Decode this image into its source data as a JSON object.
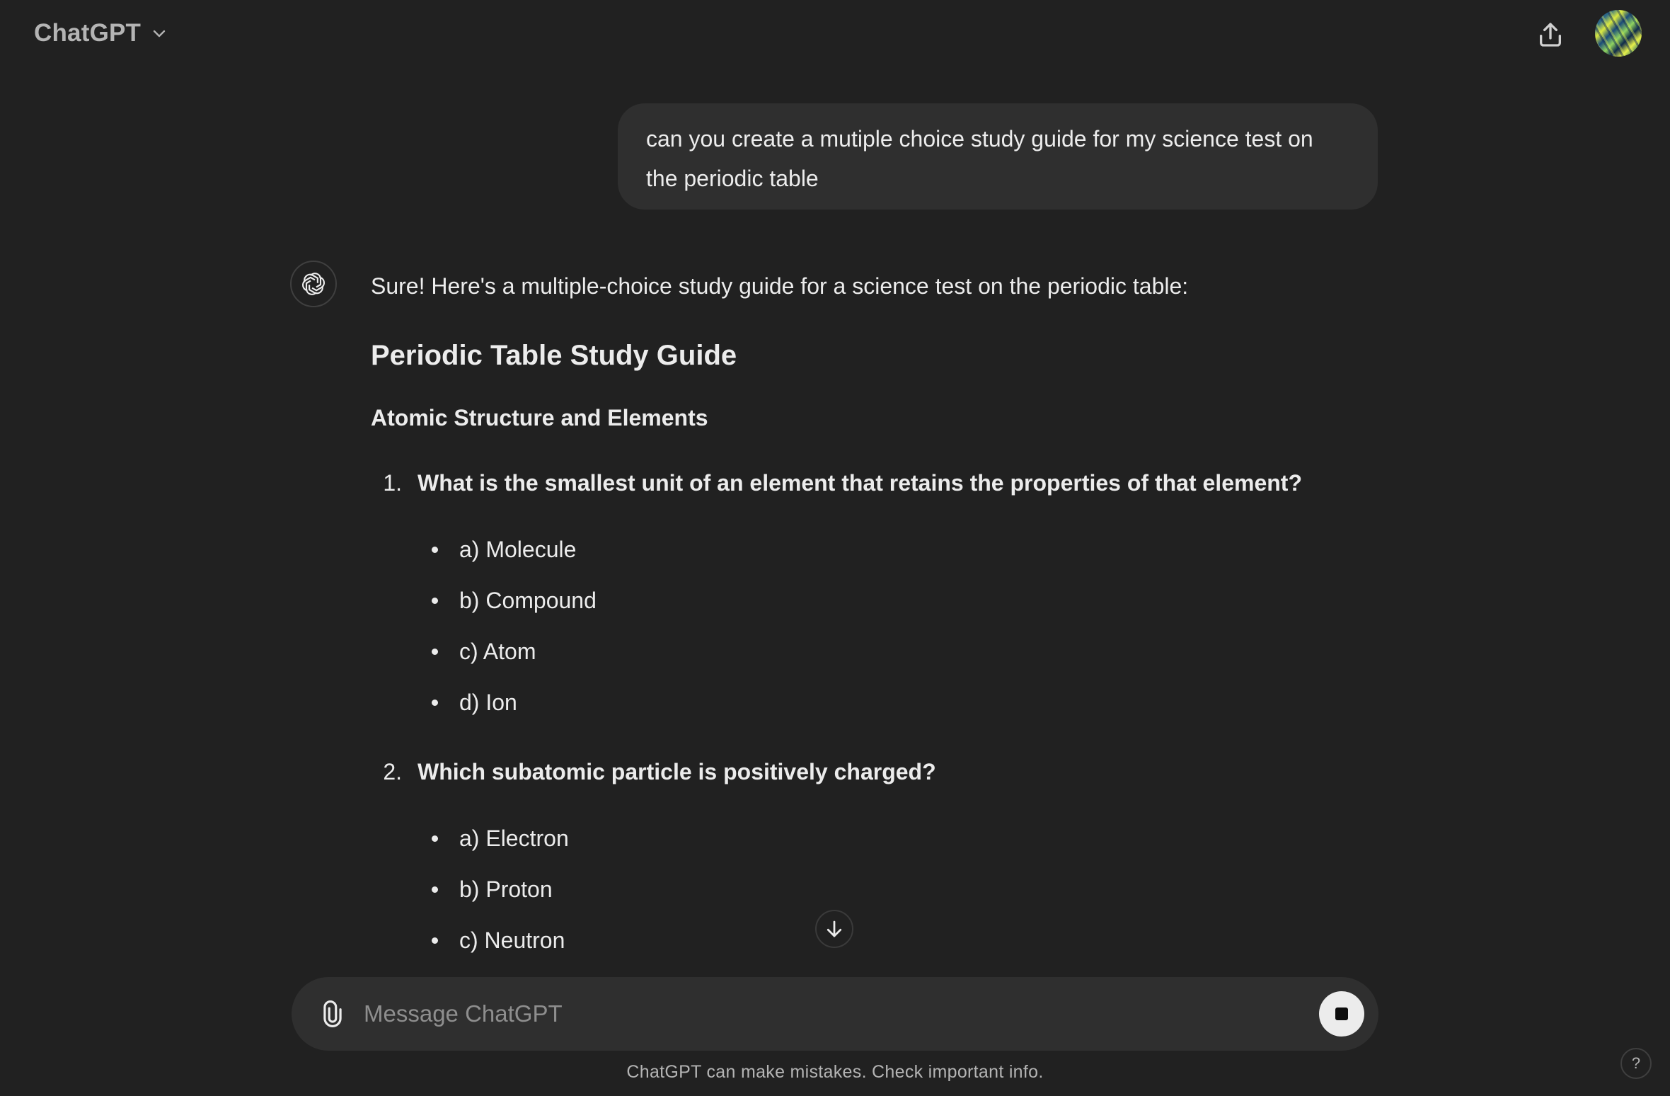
{
  "header": {
    "model_name": "ChatGPT"
  },
  "conversation": {
    "user_message": "can you create a mutiple choice study guide for my science test on the periodic table",
    "assistant": {
      "intro": "Sure! Here's a multiple-choice study guide for a science test on the periodic table:",
      "title": "Periodic Table Study Guide",
      "section": "Atomic Structure and Elements",
      "questions": [
        {
          "number": "1.",
          "text": "What is the smallest unit of an element that retains the properties of that element?",
          "options": [
            "a) Molecule",
            "b) Compound",
            "c) Atom",
            "d) Ion"
          ]
        },
        {
          "number": "2.",
          "text": "Which subatomic particle is positively charged?",
          "options": [
            "a) Electron",
            "b) Proton",
            "c) Neutron"
          ]
        }
      ]
    }
  },
  "composer": {
    "placeholder": "Message ChatGPT"
  },
  "footer": {
    "disclaimer": "ChatGPT can make mistakes. Check important info.",
    "help_label": "?"
  }
}
